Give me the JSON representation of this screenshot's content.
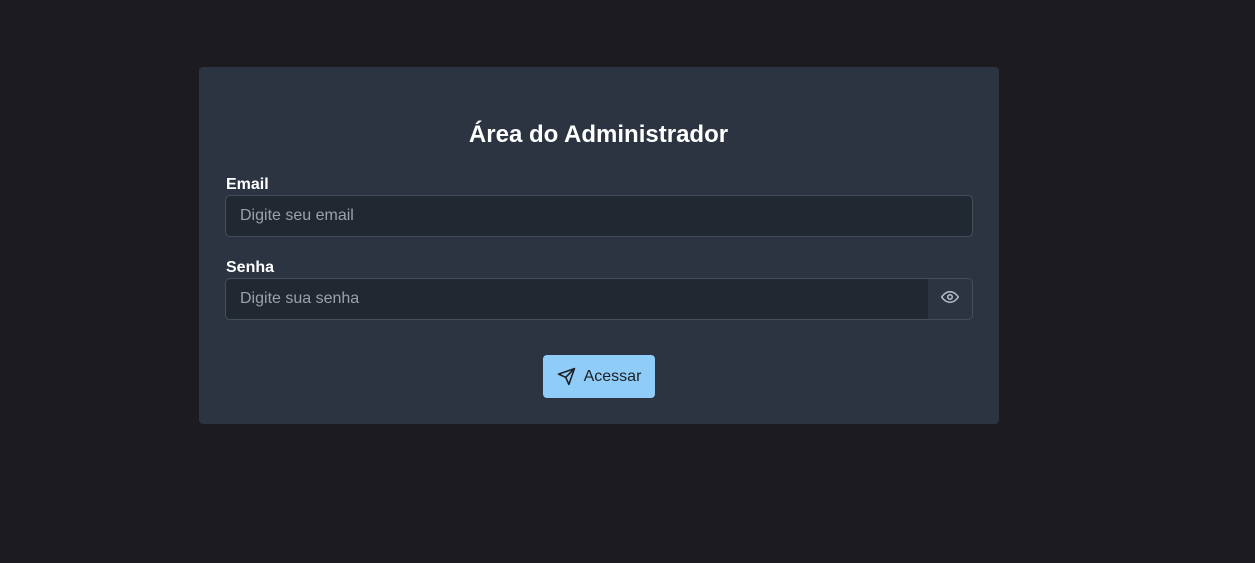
{
  "form": {
    "title": "Área do Administrador",
    "email": {
      "label": "Email",
      "placeholder": "Digite seu email",
      "value": ""
    },
    "password": {
      "label": "Senha",
      "placeholder": "Digite sua senha",
      "value": "",
      "toggle_icon": "eye-icon"
    },
    "submit": {
      "label": "Acessar",
      "icon": "send-icon"
    }
  },
  "colors": {
    "page_background": "#1c1b20",
    "card_background": "#2b3440",
    "input_background": "#212831",
    "accent": "#8fcdf8"
  }
}
